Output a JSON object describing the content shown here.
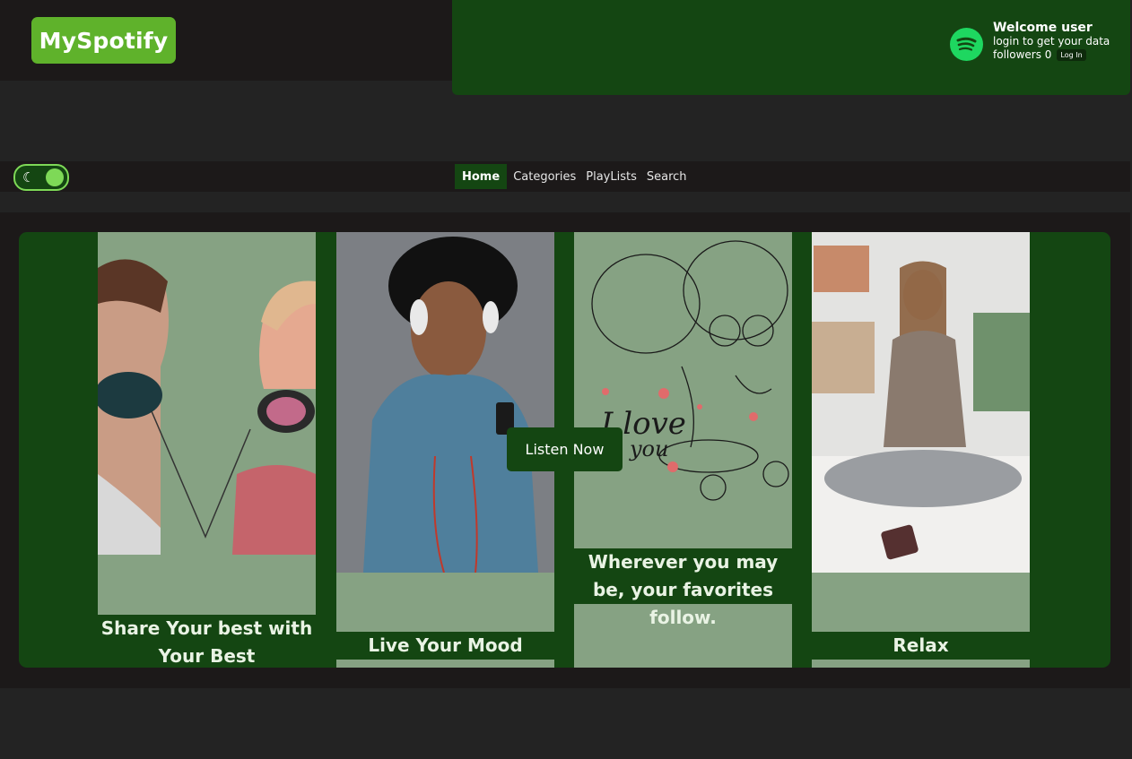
{
  "header": {
    "logo_text": "MySpotify",
    "welcome": "Welcome user",
    "login_prompt": "login to get your data",
    "followers_label": "followers 0",
    "login_button": "Log In"
  },
  "nav": {
    "items": [
      "Home",
      "Categories",
      "PlayLists",
      "Search"
    ],
    "active": "Home"
  },
  "carousel": {
    "cards": [
      {
        "title": "Share Your best with Your Best",
        "image": "couple-earphones-illustration"
      },
      {
        "title": "Live Your Mood",
        "image": "man-with-headphones-photo"
      },
      {
        "title": "Wherever you may be, your favorites follow.",
        "image": "i-love-you-scooter-sketch"
      },
      {
        "title": "Relax",
        "image": "woman-meditating-photo"
      }
    ],
    "cta": "Listen Now"
  },
  "colors": {
    "brand_green": "#5fb22b",
    "dark_green": "#144612",
    "sage": "#86a283",
    "bg_dark": "#1c1919"
  }
}
